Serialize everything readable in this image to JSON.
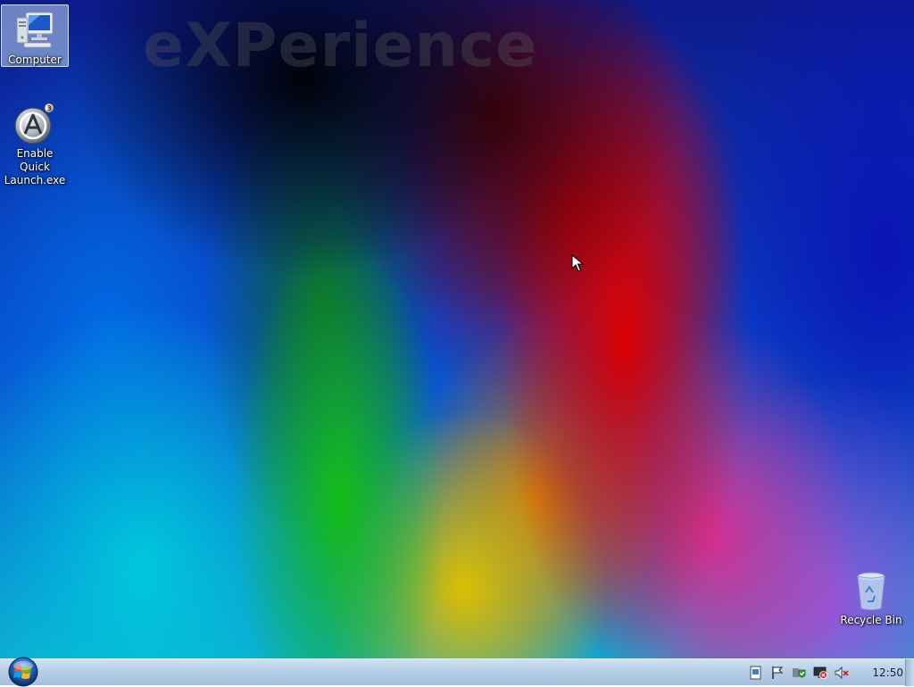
{
  "wallpaper": {
    "watermark_text": "eXPerience"
  },
  "desktop_icons": [
    {
      "label": "Computer",
      "icon": "computer-icon",
      "selected": true
    },
    {
      "label": "Enable Quick\nLaunch.exe",
      "icon": "launcher-app-icon",
      "selected": false
    },
    {
      "label": "Recycle Bin",
      "icon": "recycle-bin-icon",
      "selected": false
    }
  ],
  "taskbar": {
    "start_icon": "windows-orb-icon",
    "tray_icons": [
      "action-center-icon",
      "flag-icon",
      "security-shield-icon",
      "network-icon",
      "volume-muted-icon"
    ],
    "clock": "12:50"
  },
  "colors": {
    "selection": "#bed7f0",
    "taskbar_top": "#cfe2f3",
    "taskbar_bottom": "#a5c0dc"
  }
}
